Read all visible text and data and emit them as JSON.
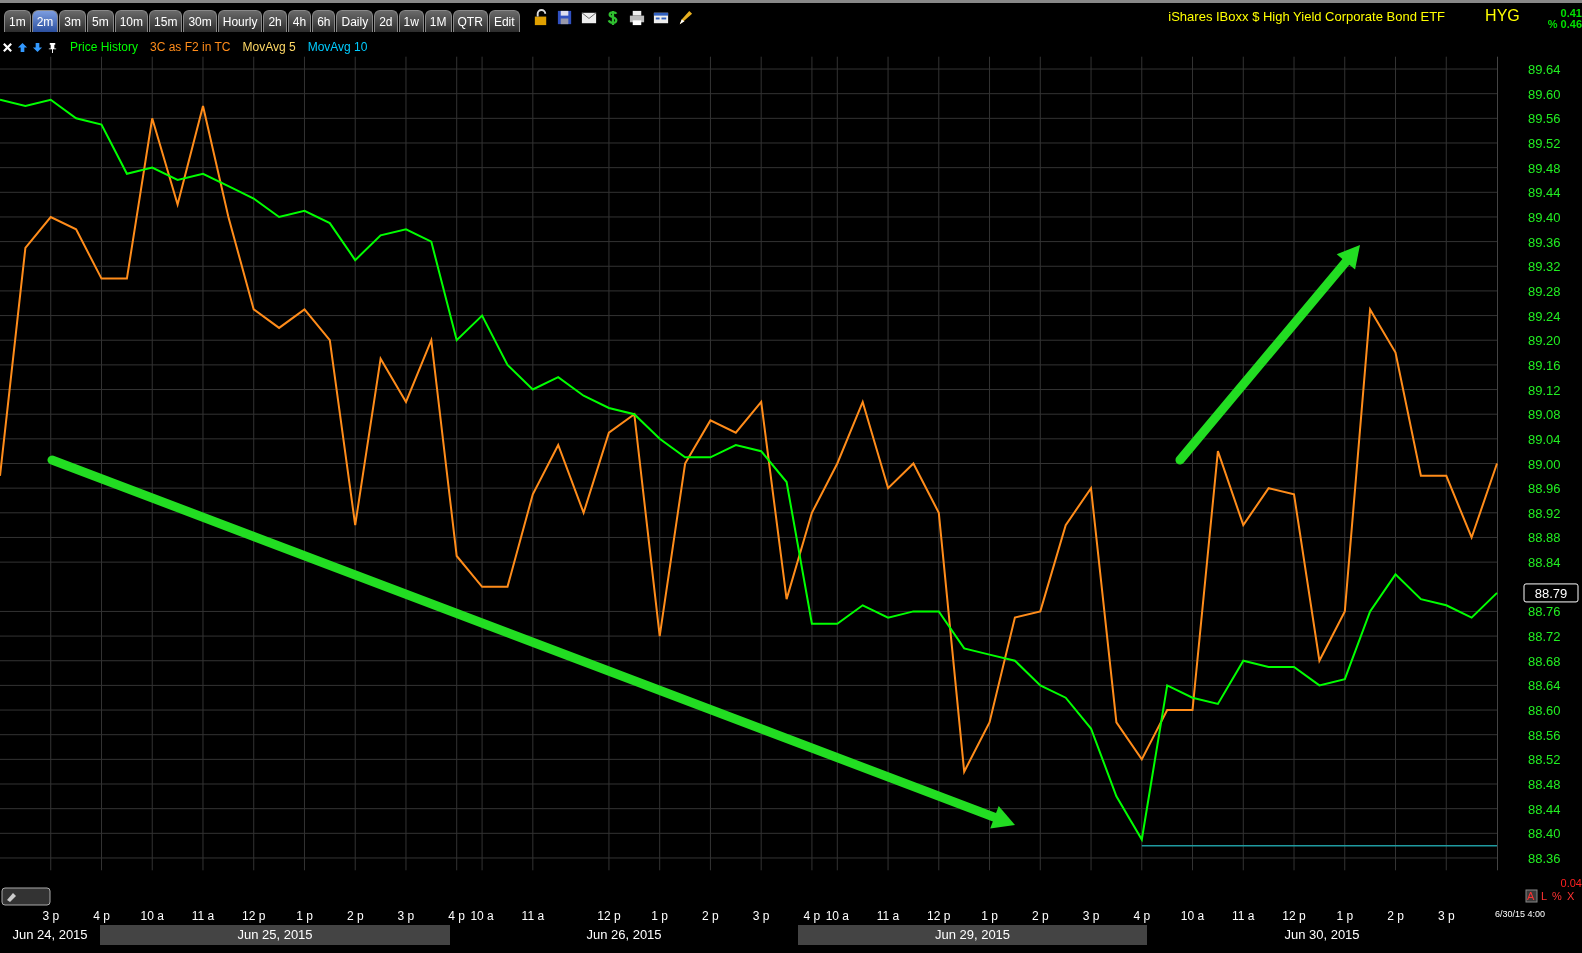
{
  "toolbar": {
    "tabs": [
      {
        "label": "1m",
        "selected": false
      },
      {
        "label": "2m",
        "selected": true
      },
      {
        "label": "3m",
        "selected": false
      },
      {
        "label": "5m",
        "selected": false
      },
      {
        "label": "10m",
        "selected": false
      },
      {
        "label": "15m",
        "selected": false
      },
      {
        "label": "30m",
        "selected": false
      },
      {
        "label": "Hourly",
        "selected": false
      },
      {
        "label": "2h",
        "selected": false
      },
      {
        "label": "4h",
        "selected": false
      },
      {
        "label": "6h",
        "selected": false
      },
      {
        "label": "Daily",
        "selected": false
      },
      {
        "label": "2d",
        "selected": false
      },
      {
        "label": "1w",
        "selected": false
      },
      {
        "label": "1M",
        "selected": false
      },
      {
        "label": "QTR",
        "selected": false
      },
      {
        "label": "Edit",
        "selected": false
      }
    ]
  },
  "title": "iShares IBoxx $ High Yield Corporate Bond ETF",
  "symbol": "HYG",
  "change": "0.41",
  "change_percent": "% 0.46",
  "legend": [
    {
      "label": "MovAvg 5",
      "color": "#ffd966"
    },
    {
      "label": "MovAvg 10",
      "color": "#00ccff"
    }
  ],
  "chart": {
    "chart_data": {
      "type": "line",
      "categories": [
        null,
        null,
        "3 p",
        null,
        "4 p",
        null,
        "10 a",
        null,
        "11 a",
        null,
        "12 p",
        null,
        "1 p",
        null,
        "2 p",
        null,
        "3 p",
        null,
        "4 p",
        "10 a",
        null,
        "11 a",
        null,
        null,
        "12 p",
        null,
        "1 p",
        null,
        "2 p",
        null,
        "3 p",
        null,
        "4 p",
        "10 a",
        null,
        "11 a",
        null,
        "12 p",
        null,
        "1 p",
        null,
        "2 p",
        null,
        "3 p",
        null,
        "4 p",
        null,
        "10 a",
        null,
        "11 a",
        null,
        "12 p",
        null,
        "1 p",
        null,
        "2 p",
        null,
        "3 p",
        null,
        null
      ],
      "series": [
        {
          "name": "Price History",
          "color": "#00ff00",
          "values": [
            89.59,
            89.58,
            89.59,
            89.56,
            89.55,
            89.47,
            89.48,
            89.46,
            89.47,
            89.45,
            89.43,
            89.4,
            89.41,
            89.39,
            89.33,
            89.37,
            89.38,
            89.36,
            89.2,
            89.24,
            89.16,
            89.12,
            89.14,
            89.11,
            89.09,
            89.08,
            89.04,
            89.01,
            89.01,
            89.03,
            89.02,
            88.97,
            88.74,
            88.74,
            88.77,
            88.75,
            88.76,
            88.76,
            88.7,
            88.69,
            88.68,
            88.64,
            88.62,
            88.57,
            88.46,
            88.39,
            88.64,
            88.62,
            88.61,
            88.68,
            88.67,
            88.67,
            88.64,
            88.65,
            88.76,
            88.82,
            88.78,
            88.77,
            88.75,
            88.79
          ]
        },
        {
          "name": "3C as F2 in TC",
          "color": "#ff8c1a",
          "values": [
            88.98,
            89.35,
            89.4,
            89.38,
            89.3,
            89.3,
            89.56,
            89.42,
            89.58,
            89.4,
            89.25,
            89.22,
            89.25,
            89.2,
            88.9,
            89.17,
            89.1,
            89.2,
            88.85,
            88.8,
            88.8,
            88.95,
            89.03,
            88.92,
            89.05,
            89.08,
            88.72,
            89.0,
            89.07,
            89.05,
            89.1,
            88.78,
            88.92,
            89.0,
            89.1,
            88.96,
            89.0,
            88.92,
            88.5,
            88.58,
            88.75,
            88.76,
            88.9,
            88.96,
            88.58,
            88.52,
            88.6,
            88.6,
            89.02,
            88.9,
            88.96,
            88.95,
            88.68,
            88.76,
            89.25,
            89.18,
            88.98,
            88.98,
            88.88,
            89.0
          ]
        }
      ],
      "ylim": [
        88.34,
        89.66
      ],
      "grid": true,
      "ref_lines": [
        {
          "axis": "y",
          "value": 88.38,
          "color": "#1f9aa0"
        }
      ],
      "yticks": [
        {
          "value": 89.64,
          "label": "89.64"
        },
        {
          "value": 89.6,
          "label": "89.60"
        },
        {
          "value": 89.56,
          "label": "89.56"
        },
        {
          "value": 89.52,
          "label": "89.52"
        },
        {
          "value": 89.48,
          "label": "89.48"
        },
        {
          "value": 89.44,
          "label": "89.44"
        },
        {
          "value": 89.4,
          "label": "89.40"
        },
        {
          "value": 89.36,
          "label": "89.36"
        },
        {
          "value": 89.32,
          "label": "89.32"
        },
        {
          "value": 89.28,
          "label": "89.28"
        },
        {
          "value": 89.24,
          "label": "89.24"
        },
        {
          "value": 89.2,
          "label": "89.20"
        },
        {
          "value": 89.16,
          "label": "89.16"
        },
        {
          "value": 89.12,
          "label": "89.12"
        },
        {
          "value": 89.08,
          "label": "89.08"
        },
        {
          "value": 89.04,
          "label": "89.04"
        },
        {
          "value": 89.0,
          "label": "89.00"
        },
        {
          "value": 88.96,
          "label": "88.96"
        },
        {
          "value": 88.92,
          "label": "88.92"
        },
        {
          "value": 88.88,
          "label": "88.88"
        },
        {
          "value": 88.84,
          "label": "88.84"
        },
        {
          "value": 88.76,
          "label": "88.76"
        },
        {
          "value": 88.72,
          "label": "88.72"
        },
        {
          "value": 88.68,
          "label": "88.68"
        },
        {
          "value": 88.64,
          "label": "88.64"
        },
        {
          "value": 88.6,
          "label": "88.60"
        },
        {
          "value": 88.56,
          "label": "88.56"
        },
        {
          "value": 88.52,
          "label": "88.52"
        },
        {
          "value": 88.48,
          "label": "88.48"
        },
        {
          "value": 88.44,
          "label": "88.44"
        },
        {
          "value": 88.4,
          "label": "88.40"
        },
        {
          "value": 88.36,
          "label": "88.36"
        }
      ]
    }
  },
  "price_tag": "88.79",
  "indicator_value": "0.04",
  "indicator_flags": [
    "A",
    "L",
    "%",
    "X"
  ],
  "timestamp": "6/30/15 4:00",
  "dates": [
    {
      "label": "Jun 24, 2015",
      "shaded": false
    },
    {
      "label": "Jun 25, 2015",
      "shaded": true
    },
    {
      "label": "Jun 26, 2015",
      "shaded": false
    },
    {
      "label": "Jun 29, 2015",
      "shaded": true
    },
    {
      "label": "Jun 30, 2015",
      "shaded": false
    }
  ]
}
